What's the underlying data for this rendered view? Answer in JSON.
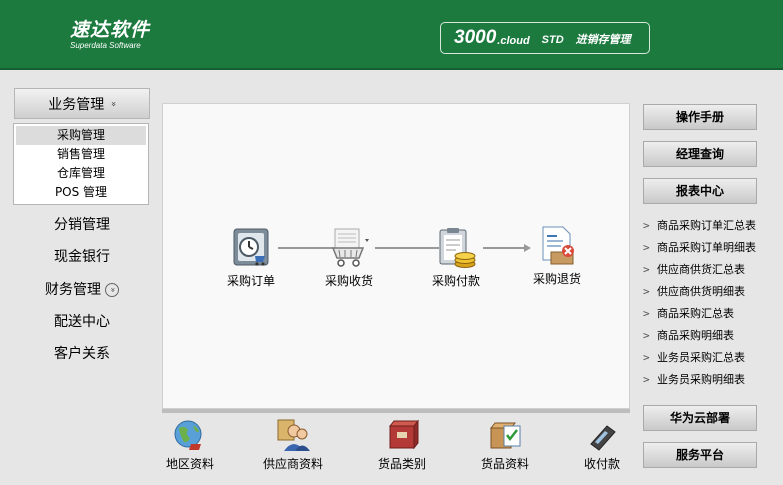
{
  "header": {
    "logo_text": "速达软件",
    "logo_sub": "Superdata Software",
    "badge_num": "3000",
    "badge_cloud": ".cloud",
    "badge_std": "STD",
    "badge_title": "进销存管理"
  },
  "sidebar": {
    "group_label": "业务管理",
    "group_chevron": "»",
    "sub_items": [
      {
        "label": "采购管理"
      },
      {
        "label": "销售管理"
      },
      {
        "label": "仓库管理"
      },
      {
        "label": "POS 管理"
      }
    ],
    "nav_items": [
      {
        "label": "分销管理"
      },
      {
        "label": "现金银行"
      },
      {
        "label": "财务管理",
        "chevron": "»"
      },
      {
        "label": "配送中心"
      },
      {
        "label": "客户关系"
      }
    ]
  },
  "flow": {
    "steps": [
      {
        "label": "采购订单",
        "icon": "purchase-order-icon"
      },
      {
        "label": "采购收货",
        "icon": "shopping-cart-icon"
      },
      {
        "label": "采购付款",
        "icon": "payment-coins-icon"
      },
      {
        "label": "采购退货",
        "icon": "return-document-icon"
      }
    ]
  },
  "bottom": {
    "items": [
      {
        "label": "地区资料",
        "icon": "globe-icon"
      },
      {
        "label": "供应商资料",
        "icon": "supplier-people-icon"
      },
      {
        "label": "货品类别",
        "icon": "goods-category-icon"
      },
      {
        "label": "货品资料",
        "icon": "goods-info-icon"
      },
      {
        "label": "收付款",
        "icon": "pos-terminal-icon"
      }
    ]
  },
  "right": {
    "manual": "操作手册",
    "manager_query": "经理查询",
    "report_center": "报表中心",
    "reports": [
      "商品采购订单汇总表",
      "商品采购订单明细表",
      "供应商供货汇总表",
      "供应商供货明细表",
      "商品采购汇总表",
      "商品采购明细表",
      "业务员采购汇总表",
      "业务员采购明细表"
    ],
    "huawei": "华为云部署",
    "service": "服务平台"
  },
  "colors": {
    "header_green": "#1c7a3f",
    "panel_bg": "#f9f9f9"
  }
}
